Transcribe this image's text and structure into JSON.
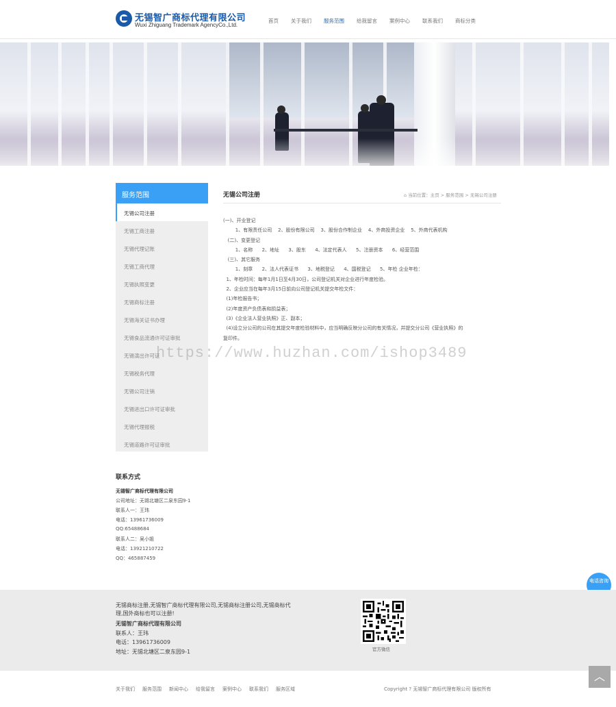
{
  "header": {
    "logo_cn": "无锡智广商标代理有限公司",
    "logo_en": "Wuxi Zhiguang Trademark AgencyCo.,Ltd.",
    "nav": [
      {
        "label": "首页"
      },
      {
        "label": "关于我们"
      },
      {
        "label": "服务范围",
        "active": true
      },
      {
        "label": "给我留言"
      },
      {
        "label": "案例中心"
      },
      {
        "label": "联系我们"
      },
      {
        "label": "商标分类"
      }
    ]
  },
  "sidebar": {
    "title": "服务范围",
    "items": [
      {
        "label": "无锡公司注册",
        "active": true
      },
      {
        "label": "无锡工商注册"
      },
      {
        "label": "无锡代理记账"
      },
      {
        "label": "无锡工商代理"
      },
      {
        "label": "无锡执照变更"
      },
      {
        "label": "无锡商标注册"
      },
      {
        "label": "无锡海关证书办理"
      },
      {
        "label": "无锡食品流通许可证审批"
      },
      {
        "label": "无锡演出许可证"
      },
      {
        "label": "无锡税务代理"
      },
      {
        "label": "无锡公司注销"
      },
      {
        "label": "无锡进出口许可证审批"
      },
      {
        "label": "无锡代理报税"
      },
      {
        "label": "无锡道路许可证审批"
      }
    ]
  },
  "content": {
    "title": "无锡公司注册",
    "breadcrumb": "当前位置：主页 > 服务范围 > 无锡公司注册",
    "paragraphs": [
      "(一)、开业登记",
      "        1、有限责任公司    2、股份有限公司    3、股份合作制企业    4、外商投资企业    5、外商代表机构",
      "   (二)、变更登记",
      "        1、名称      2、地址      3、股东      4、法定代表人      5、注册资本      6、经营范围",
      "   (三)、其它服务",
      "        1、刻章      2、法人代表证书      3、地税登记      4、国税登记      5、年检 企业年检：",
      "  1、年检时间：每年1月1日至4月30日，公司登记机关对企业进行年度检验。",
      "  2、企业应当在每年3月15日前向公司登记机关提交年检文件：",
      "  (1)年检报告书；",
      "  (2)年度资产负债表和损益表；",
      "  (3)《企业法人营业执照》正、副本；",
      "  (4)设立分公司的公司在其提交年度检验材料中，应当明确反映分公司的有关情况，并提交分公司《营业执照》的",
      "复印件。"
    ],
    "watermark": "https://www.huzhan.com/ishop3489"
  },
  "contact": {
    "title": "联系方式",
    "company": "无锡智广商标代理有限公司",
    "lines": [
      "公司地址：无锡北塘区二泉东园9-1",
      "联系人一：王玮",
      "电话：13961736009",
      "QQ:65488684",
      "联系人二：吴小姐",
      "电话：13921210722",
      "QQ：465887459"
    ]
  },
  "float_button": "电话咨询",
  "footer": {
    "description": "无锡商标注册,无锡智广商标代理有限公司,无锡商标注册公司,无锡商标代理,国外商标也可以注册!",
    "company": "无锡智广商标代理有限公司",
    "lines": [
      "联系人：王玮",
      "电话：13961736009",
      "地址：无锡北塘区二泉东园9-1"
    ],
    "qr_caption": "官方微信",
    "to_top": "︿",
    "bottom_nav": [
      {
        "label": "关于我们"
      },
      {
        "label": "服务范围"
      },
      {
        "label": "新闻中心"
      },
      {
        "label": "给我留言"
      },
      {
        "label": "案例中心"
      },
      {
        "label": "联系我们"
      },
      {
        "label": "服务区域"
      }
    ],
    "copyright": "Copyright ? 无锡智广商标代理有限公司 版权所有"
  }
}
